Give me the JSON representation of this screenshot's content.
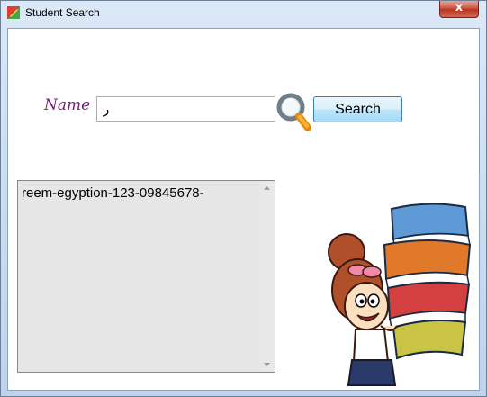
{
  "window": {
    "title": "Student Search",
    "close_label": "x"
  },
  "form": {
    "name_label": "Name",
    "name_value": "ر",
    "search_label": "Search"
  },
  "results": {
    "items": [
      "reem-egyption-123-09845678-"
    ]
  },
  "icons": {
    "app": "app-icon",
    "search": "magnifier-icon",
    "close": "close-icon",
    "scroll_up": "chevron-up-icon",
    "scroll_down": "chevron-down-icon"
  }
}
